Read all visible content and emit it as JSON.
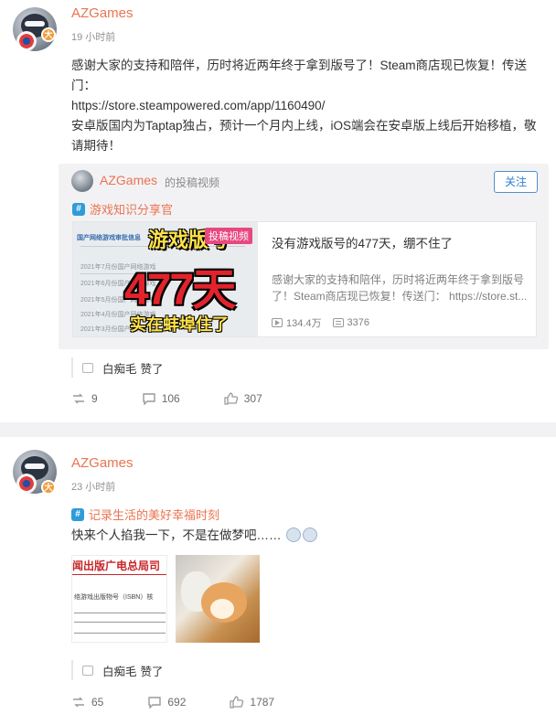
{
  "post1": {
    "user": "AZGames",
    "verified_badge": "大",
    "time": "19 小时前",
    "text_lines": [
      "感谢大家的支持和陪伴，历时将近两年终于拿到版号了！Steam商店现已恢复！传送门：",
      "https://store.steampowered.com/app/1160490/",
      "安卓版国内为Taptap独占，预计一个月内上线，iOS端会在安卓版上线后开始移植，敬请期待！"
    ],
    "repost": {
      "user": "AZGames",
      "subtitle": "的投稿视频",
      "follow_label": "关注",
      "topic_icon": "#",
      "topic": "游戏知识分享官",
      "video": {
        "label": "投稿视频",
        "overlay_top": "游戏版号",
        "overlay_mid": "477天",
        "overlay_bottom": "实在蚌埠住了",
        "doc_heading": "国产网络游戏审批信息",
        "doc_rows": [
          "2021年7月份国产网络游戏",
          "2021年6月份国产网络游戏",
          "2021年5月份国产网络游戏",
          "2021年4月份国产网络游戏",
          "2021年3月份国产网络游戏"
        ],
        "title": "没有游戏版号的477天，绷不住了",
        "desc": "感谢大家的支持和陪伴，历时将近两年终于拿到版号了！Steam商店现已恢复！传送门： https://store.st...",
        "plays": "134.4万",
        "comments": "3376"
      }
    },
    "liked_by": "白痴毛",
    "liked_suffix": "赞了",
    "reposts": "9",
    "comments": "106",
    "likes": "307"
  },
  "post2": {
    "user": "AZGames",
    "verified_badge": "大",
    "time": "23 小时前",
    "topic_icon": "#",
    "topic": "记录生活的美好幸福时刻",
    "text": "快来个人掐我一下，不是在做梦吧……",
    "pic1_header": "闻出版广电总局司",
    "pic1_sub": "络游戏出版物号（ISBN）核",
    "liked_by": "白痴毛",
    "liked_suffix": "赞了",
    "reposts": "65",
    "comments": "692",
    "likes": "1787"
  },
  "colors": {
    "username": "#eb7350",
    "link_blue": "#2e7dd1",
    "topic_icon": "#2f9bd8",
    "video_label": "#e8477f"
  }
}
